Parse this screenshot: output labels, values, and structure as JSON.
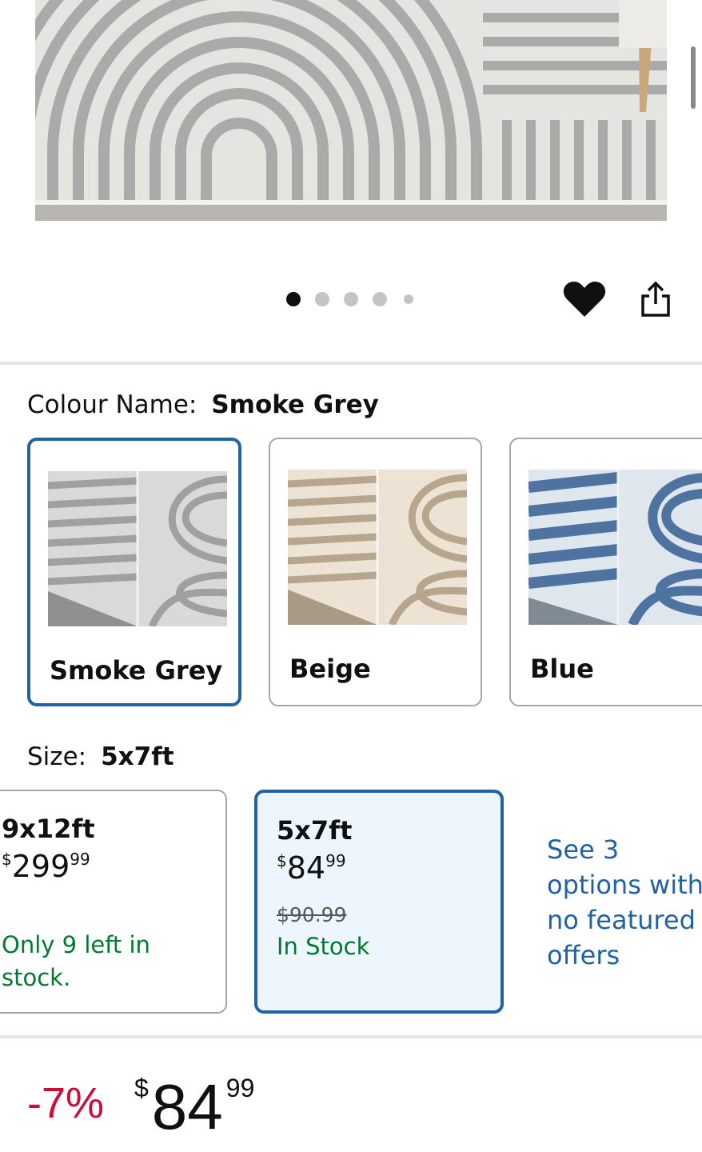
{
  "gallery": {
    "dot_count": 5,
    "active_index": 0
  },
  "colour": {
    "label": "Colour Name:",
    "selected_value": "Smoke Grey",
    "options": [
      {
        "label": "Smoke Grey",
        "selected": true,
        "tone": "#9fa1a0",
        "light": "#e2e3de"
      },
      {
        "label": "Beige",
        "selected": false,
        "tone": "#b7a58e",
        "light": "#efe6d9"
      },
      {
        "label": "Blue",
        "selected": false,
        "tone": "#4f73a0",
        "light": "#dfe6ee"
      }
    ]
  },
  "size": {
    "label": "Size:",
    "selected_value": "5x7ft",
    "options": [
      {
        "name": "9x12ft",
        "currency": "$",
        "price_whole": "299",
        "price_fraction": "99",
        "was_price": "",
        "stock": "Only 9 left in stock.",
        "selected": false
      },
      {
        "name": "5x7ft",
        "currency": "$",
        "price_whole": "84",
        "price_fraction": "99",
        "was_price": "$90.99",
        "stock": "In Stock",
        "selected": true
      }
    ],
    "see_more": "See 3\noptions with\nno featured\noffers"
  },
  "price": {
    "discount": "-7%",
    "currency": "$",
    "whole": "84",
    "fraction": "99"
  },
  "colors": {
    "accent": "#2162a1",
    "selected_bg": "#edf6fd",
    "discount": "#cc0c39",
    "stock": "#007a30"
  }
}
